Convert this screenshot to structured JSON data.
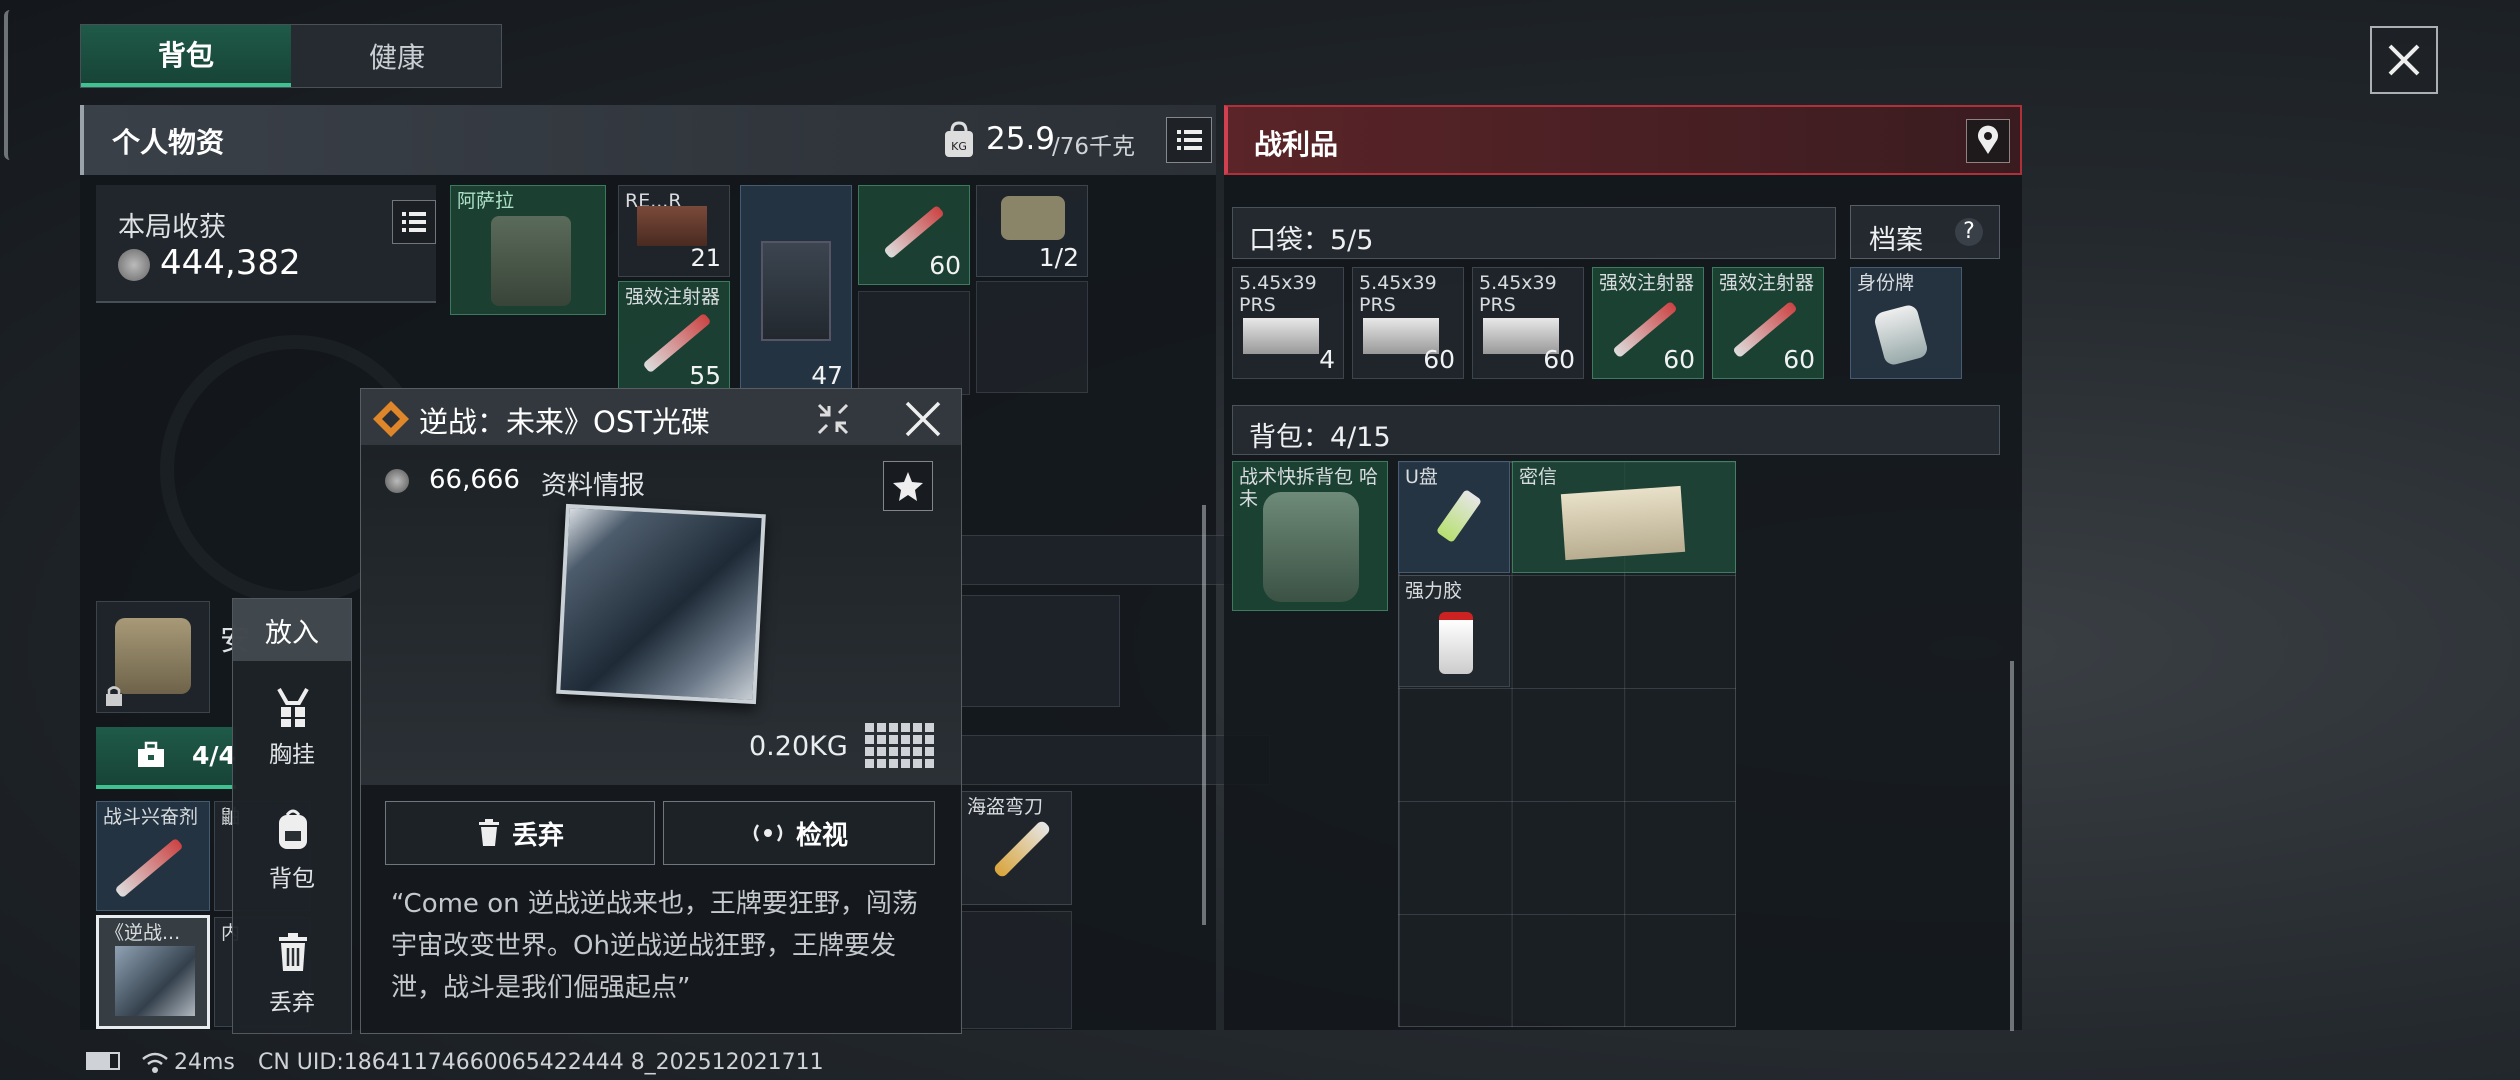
{
  "tabs": [
    {
      "label": "背包"
    },
    {
      "label": "健康"
    }
  ],
  "left_panel": {
    "title": "个人物资",
    "weight": "25.9",
    "weight_max": "/76千克"
  },
  "earnings": {
    "label": "本局收获",
    "value": "444,382"
  },
  "personal_items": {
    "item1_label": "阿萨拉",
    "item2_label": "RE...R",
    "item2_count": "21",
    "item3_label": "强效注射器",
    "item3_count": "55",
    "item4_count": "47",
    "item5_count": "60",
    "item6_count": "1/2",
    "loadout_count": "4/4",
    "slot_a_label": "战斗兴奋剂",
    "slot_b_label": "鼬",
    "slot_c_label": "《逆战...",
    "slot_d_label": "内",
    "knife_label": "海盗弯刀",
    "locked_label": "安"
  },
  "put_menu": {
    "title": "放入",
    "items": [
      {
        "label": "胸挂"
      },
      {
        "label": "背包"
      },
      {
        "label": "丢弃"
      }
    ]
  },
  "popup": {
    "title": "逆战：未来》OST光碟",
    "value": "66,666",
    "category": "资料情报",
    "weight": "0.20KG",
    "discard_label": "丢弃",
    "inspect_label": "检视",
    "description": "“Come on 逆战逆战来也，王牌要狂野，闯荡宇宙改变世界。Oh逆战逆战狂野，王牌要发泄，战斗是我们倔强起点”"
  },
  "loot_panel": {
    "title": "战利品",
    "pocket": {
      "label": "口袋：5/5"
    },
    "archive": {
      "label": "档案",
      "badge": "?"
    },
    "pocket_items": [
      {
        "label": "5.45x39 PRS",
        "count": "4"
      },
      {
        "label": "5.45x39 PRS",
        "count": "60"
      },
      {
        "label": "5.45x39 PRS",
        "count": "60"
      },
      {
        "label": "强效注射器",
        "count": "60"
      },
      {
        "label": "强效注射器",
        "count": "60"
      }
    ],
    "dogtag": {
      "label": "身份牌"
    },
    "backpack": {
      "label": "背包：4/15"
    },
    "backpack_items": {
      "bag": "战术快拆背包 哈未",
      "usb": "U盘",
      "letter": "密信",
      "glue": "强力胶"
    }
  },
  "status_bar": {
    "ping": "24ms",
    "uid": "CN UID:18641174660065422444 8_202512021711"
  },
  "colors": {
    "accent_green": "#3aa57a",
    "accent_red": "#c0323c"
  }
}
